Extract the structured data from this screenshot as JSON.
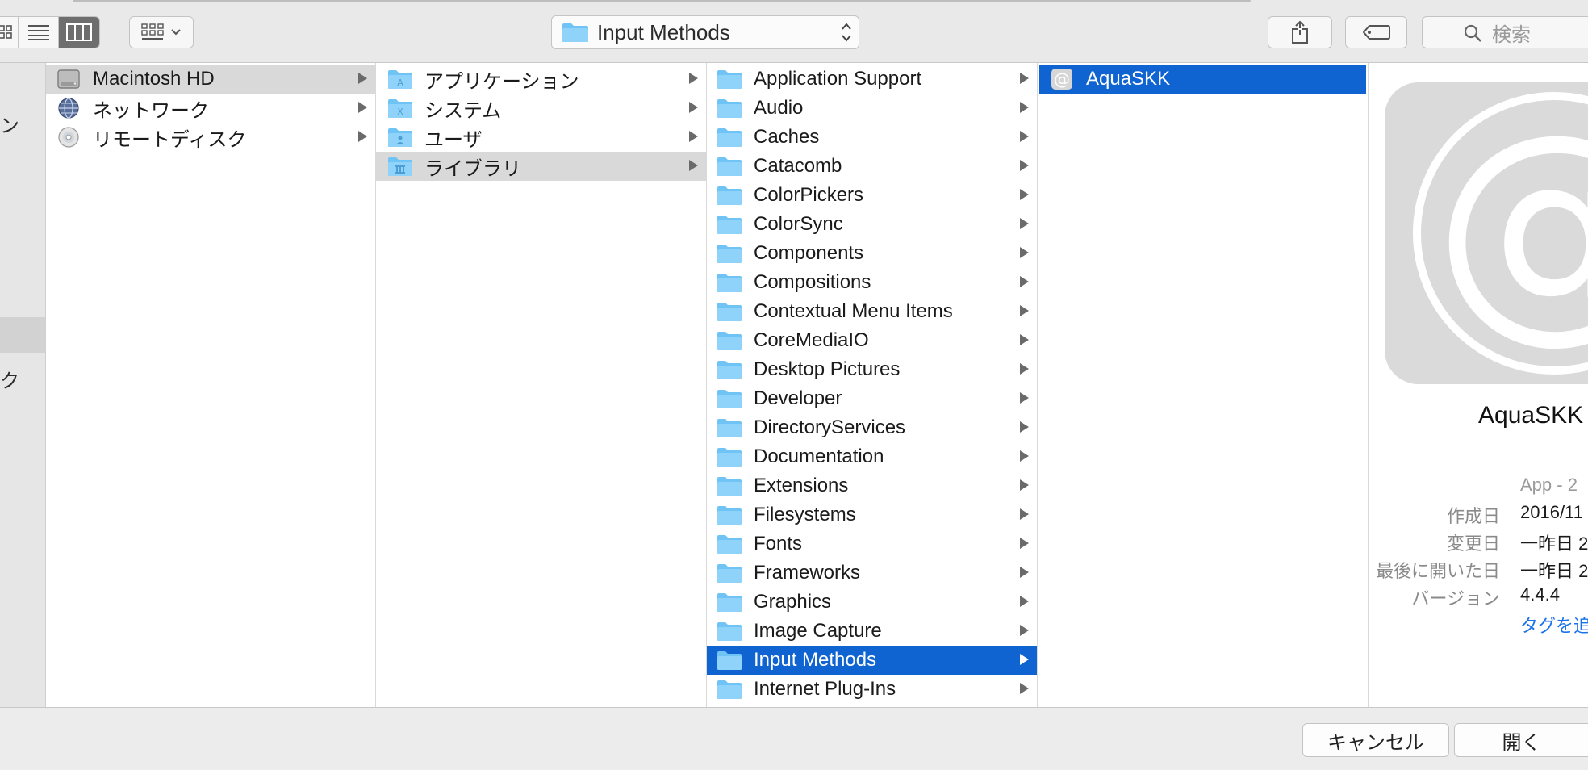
{
  "toolbar": {
    "location": "Input Methods",
    "search_placeholder": "検索"
  },
  "sidebar": {
    "fragments": [
      "ン",
      "ク"
    ]
  },
  "column1": [
    {
      "label": "Macintosh HD",
      "icon": "hard-drive-icon"
    },
    {
      "label": "ネットワーク",
      "icon": "network-globe-icon"
    },
    {
      "label": "リモートディスク",
      "icon": "optical-disc-icon"
    }
  ],
  "column2": [
    {
      "label": "アプリケーション",
      "icon": "applications-folder-icon"
    },
    {
      "label": "システム",
      "icon": "system-folder-icon"
    },
    {
      "label": "ユーザ",
      "icon": "users-folder-icon"
    },
    {
      "label": "ライブラリ",
      "icon": "library-folder-icon"
    }
  ],
  "column3": [
    "Application Support",
    "Audio",
    "Caches",
    "Catacomb",
    "ColorPickers",
    "ColorSync",
    "Components",
    "Compositions",
    "Contextual Menu Items",
    "CoreMediaIO",
    "Desktop Pictures",
    "Developer",
    "DirectoryServices",
    "Documentation",
    "Extensions",
    "Filesystems",
    "Fonts",
    "Frameworks",
    "Graphics",
    "Image Capture",
    "Input Methods",
    "Internet Plug-Ins"
  ],
  "column4": [
    {
      "label": "AquaSKK",
      "icon": "at-sign-app-icon"
    }
  ],
  "preview": {
    "name": "AquaSKK",
    "kind": "App - 2",
    "created_label": "作成日",
    "created_value": "2016/11",
    "modified_label": "変更日",
    "modified_value": "一昨日 2",
    "opened_label": "最後に開いた日",
    "opened_value": "一昨日 2",
    "version_label": "バージョン",
    "version_value": "4.4.4",
    "add_tags": "タグを追"
  },
  "bottom": {
    "cancel": "キャンセル",
    "open": "開く"
  },
  "colors": {
    "selection_blue": "#0f64d2",
    "folder_blue": "#6fc4f5",
    "link_blue": "#1a73e8"
  }
}
